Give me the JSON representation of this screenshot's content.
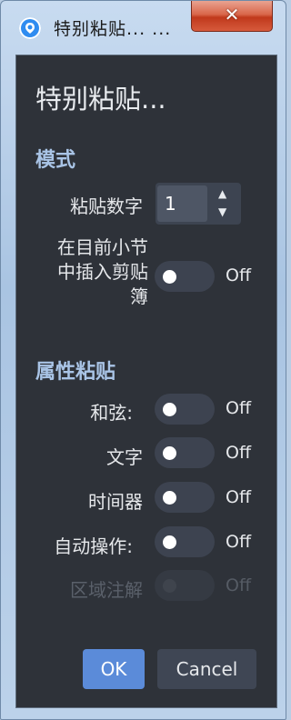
{
  "window": {
    "title": "特别粘贴... ...",
    "close_glyph": "✕",
    "accent": "#5b8bd9"
  },
  "dialog": {
    "heading": "特别粘贴...",
    "mode_section": "模式",
    "paste_count_label": "粘贴数字",
    "paste_count_value": "1",
    "insert_label_line1": "在目前小节",
    "insert_label_line2": "中插入剪贴",
    "insert_label_line3": "簿",
    "insert_state": "Off",
    "attr_section": "属性粘贴",
    "attributes": [
      {
        "label": "和弦:",
        "state": "Off",
        "enabled": true
      },
      {
        "label": "文字",
        "state": "Off",
        "enabled": true
      },
      {
        "label": "时间器",
        "state": "Off",
        "enabled": true
      },
      {
        "label": "自动操作:",
        "state": "Off",
        "enabled": true
      },
      {
        "label": "区域注解",
        "state": "Off",
        "enabled": false
      }
    ],
    "ok_label": "OK",
    "cancel_label": "Cancel"
  }
}
